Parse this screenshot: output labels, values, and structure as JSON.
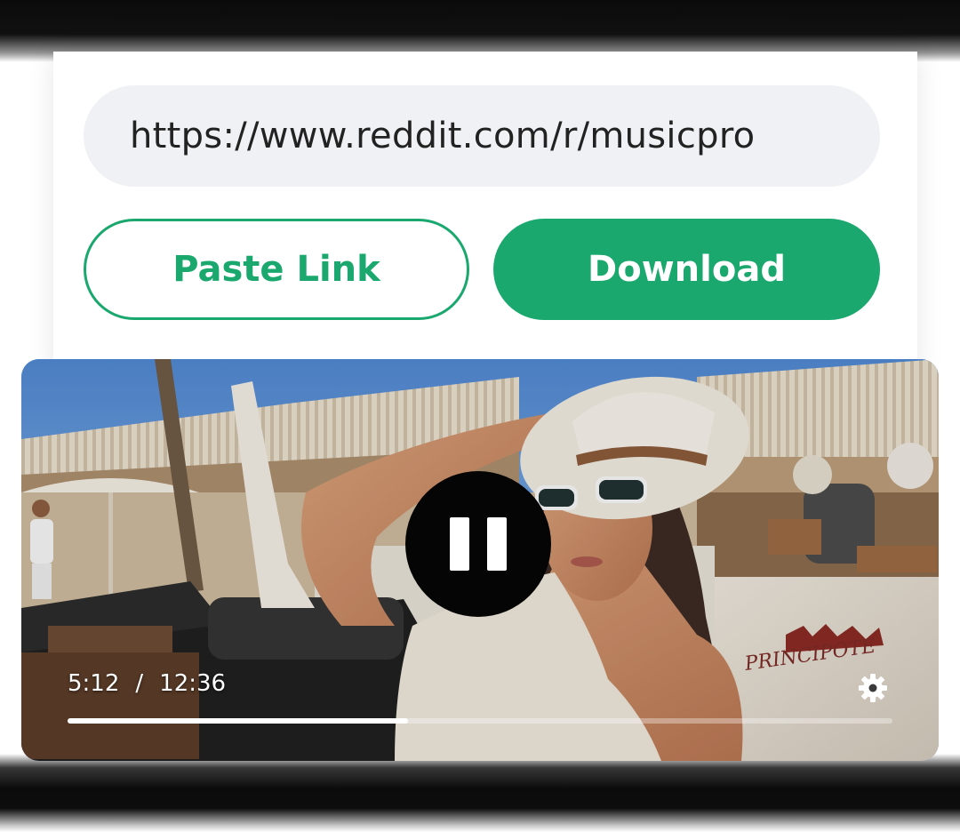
{
  "url_bar": {
    "value": "https://www.reddit.com/r/musicpro"
  },
  "buttons": {
    "paste_label": "Paste Link",
    "download_label": "Download"
  },
  "player": {
    "current_time": "5:12",
    "separator": "/",
    "total_time": "12:36",
    "progress_fraction": 0.413,
    "state": "playing",
    "control_icon": "pause-icon",
    "settings_icon": "gear-icon",
    "video_signage_text": "PRINCIPOTE"
  },
  "colors": {
    "accent": "#1aa86e",
    "url_bg": "#f0f1f4",
    "pause_bg": "#050505"
  }
}
